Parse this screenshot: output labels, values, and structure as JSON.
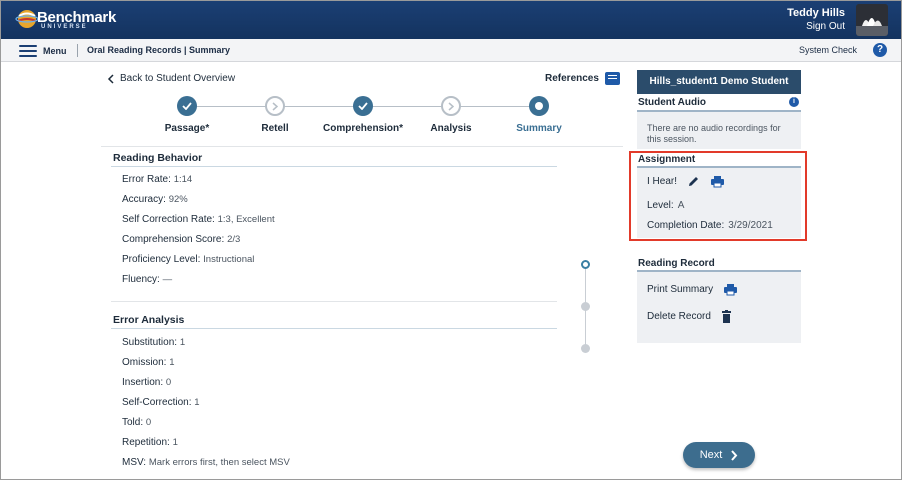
{
  "header": {
    "logo_text": "Benchmark",
    "logo_sub": "UNIVERSE",
    "user_name": "Teddy Hills",
    "sign_out": "Sign Out"
  },
  "subnav": {
    "menu_label": "Menu",
    "breadcrumb": "Oral Reading Records | Summary",
    "system_check": "System Check",
    "help_glyph": "?"
  },
  "nav": {
    "back_label": "Back to Student Overview",
    "references_label": "References"
  },
  "stepper": {
    "steps": [
      {
        "label": "Passage*",
        "state": "done"
      },
      {
        "label": "Retell",
        "state": "pending"
      },
      {
        "label": "Comprehension*",
        "state": "done"
      },
      {
        "label": "Analysis",
        "state": "pending"
      },
      {
        "label": "Summary",
        "state": "current"
      }
    ]
  },
  "reading_behavior": {
    "title": "Reading Behavior",
    "fields": [
      {
        "label": "Error Rate:",
        "value": "1:14"
      },
      {
        "label": "Accuracy:",
        "value": "92%"
      },
      {
        "label": "Self Correction Rate:",
        "value": "1:3, Excellent"
      },
      {
        "label": "Comprehension Score:",
        "value": "2/3"
      },
      {
        "label": "Proficiency Level:",
        "value": "Instructional"
      },
      {
        "label": "Fluency:",
        "value": "—"
      }
    ]
  },
  "error_analysis": {
    "title": "Error Analysis",
    "fields": [
      {
        "label": "Substitution:",
        "value": "1"
      },
      {
        "label": "Omission:",
        "value": "1"
      },
      {
        "label": "Insertion:",
        "value": "0"
      },
      {
        "label": "Self-Correction:",
        "value": "1"
      },
      {
        "label": "Told:",
        "value": "0"
      },
      {
        "label": "Repetition:",
        "value": "1"
      },
      {
        "label": "MSV:",
        "value": "Mark errors first, then select MSV"
      }
    ]
  },
  "right_panel": {
    "student_name": "Hills_student1 Demo Student",
    "student_audio": {
      "title": "Student Audio",
      "info_glyph": "i",
      "message": "There are no audio recordings for this session."
    },
    "assignment": {
      "title": "Assignment",
      "book_title": "I Hear!",
      "level_label": "Level:",
      "level_value": "A",
      "completion_label": "Completion Date:",
      "completion_value": "3/29/2021"
    },
    "reading_record": {
      "title": "Reading Record",
      "print_label": "Print Summary",
      "delete_label": "Delete Record"
    }
  },
  "footer": {
    "next_label": "Next"
  },
  "colors": {
    "header_bg": "#1b3f74",
    "accent": "#3a6f93",
    "highlight_border": "#e23a2a",
    "icon_blue": "#1f5aa8"
  }
}
